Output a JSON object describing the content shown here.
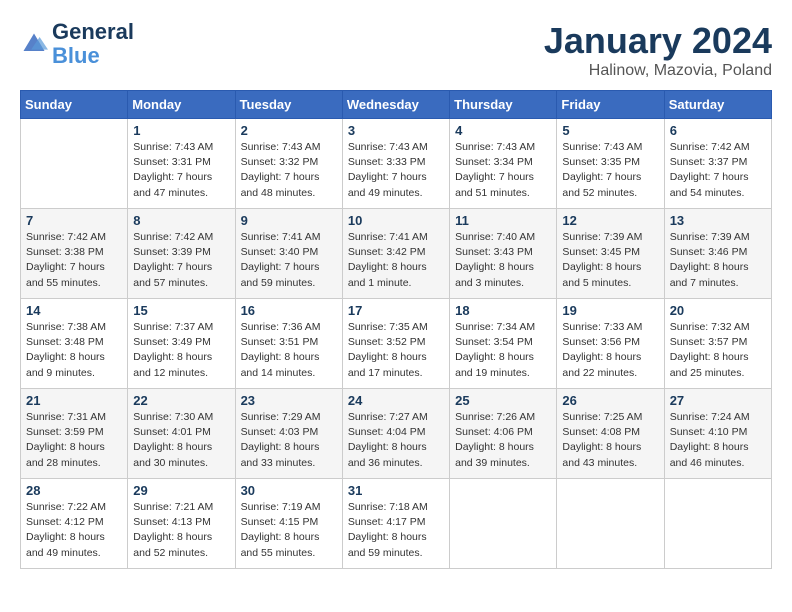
{
  "header": {
    "logo": {
      "line1": "General",
      "line2": "Blue"
    },
    "title": "January 2024",
    "location": "Halinow, Mazovia, Poland"
  },
  "days_of_week": [
    "Sunday",
    "Monday",
    "Tuesday",
    "Wednesday",
    "Thursday",
    "Friday",
    "Saturday"
  ],
  "weeks": [
    [
      {
        "day": "",
        "sunrise": "",
        "sunset": "",
        "daylight": ""
      },
      {
        "day": "1",
        "sunrise": "Sunrise: 7:43 AM",
        "sunset": "Sunset: 3:31 PM",
        "daylight": "Daylight: 7 hours and 47 minutes."
      },
      {
        "day": "2",
        "sunrise": "Sunrise: 7:43 AM",
        "sunset": "Sunset: 3:32 PM",
        "daylight": "Daylight: 7 hours and 48 minutes."
      },
      {
        "day": "3",
        "sunrise": "Sunrise: 7:43 AM",
        "sunset": "Sunset: 3:33 PM",
        "daylight": "Daylight: 7 hours and 49 minutes."
      },
      {
        "day": "4",
        "sunrise": "Sunrise: 7:43 AM",
        "sunset": "Sunset: 3:34 PM",
        "daylight": "Daylight: 7 hours and 51 minutes."
      },
      {
        "day": "5",
        "sunrise": "Sunrise: 7:43 AM",
        "sunset": "Sunset: 3:35 PM",
        "daylight": "Daylight: 7 hours and 52 minutes."
      },
      {
        "day": "6",
        "sunrise": "Sunrise: 7:42 AM",
        "sunset": "Sunset: 3:37 PM",
        "daylight": "Daylight: 7 hours and 54 minutes."
      }
    ],
    [
      {
        "day": "7",
        "sunrise": "Sunrise: 7:42 AM",
        "sunset": "Sunset: 3:38 PM",
        "daylight": "Daylight: 7 hours and 55 minutes."
      },
      {
        "day": "8",
        "sunrise": "Sunrise: 7:42 AM",
        "sunset": "Sunset: 3:39 PM",
        "daylight": "Daylight: 7 hours and 57 minutes."
      },
      {
        "day": "9",
        "sunrise": "Sunrise: 7:41 AM",
        "sunset": "Sunset: 3:40 PM",
        "daylight": "Daylight: 7 hours and 59 minutes."
      },
      {
        "day": "10",
        "sunrise": "Sunrise: 7:41 AM",
        "sunset": "Sunset: 3:42 PM",
        "daylight": "Daylight: 8 hours and 1 minute."
      },
      {
        "day": "11",
        "sunrise": "Sunrise: 7:40 AM",
        "sunset": "Sunset: 3:43 PM",
        "daylight": "Daylight: 8 hours and 3 minutes."
      },
      {
        "day": "12",
        "sunrise": "Sunrise: 7:39 AM",
        "sunset": "Sunset: 3:45 PM",
        "daylight": "Daylight: 8 hours and 5 minutes."
      },
      {
        "day": "13",
        "sunrise": "Sunrise: 7:39 AM",
        "sunset": "Sunset: 3:46 PM",
        "daylight": "Daylight: 8 hours and 7 minutes."
      }
    ],
    [
      {
        "day": "14",
        "sunrise": "Sunrise: 7:38 AM",
        "sunset": "Sunset: 3:48 PM",
        "daylight": "Daylight: 8 hours and 9 minutes."
      },
      {
        "day": "15",
        "sunrise": "Sunrise: 7:37 AM",
        "sunset": "Sunset: 3:49 PM",
        "daylight": "Daylight: 8 hours and 12 minutes."
      },
      {
        "day": "16",
        "sunrise": "Sunrise: 7:36 AM",
        "sunset": "Sunset: 3:51 PM",
        "daylight": "Daylight: 8 hours and 14 minutes."
      },
      {
        "day": "17",
        "sunrise": "Sunrise: 7:35 AM",
        "sunset": "Sunset: 3:52 PM",
        "daylight": "Daylight: 8 hours and 17 minutes."
      },
      {
        "day": "18",
        "sunrise": "Sunrise: 7:34 AM",
        "sunset": "Sunset: 3:54 PM",
        "daylight": "Daylight: 8 hours and 19 minutes."
      },
      {
        "day": "19",
        "sunrise": "Sunrise: 7:33 AM",
        "sunset": "Sunset: 3:56 PM",
        "daylight": "Daylight: 8 hours and 22 minutes."
      },
      {
        "day": "20",
        "sunrise": "Sunrise: 7:32 AM",
        "sunset": "Sunset: 3:57 PM",
        "daylight": "Daylight: 8 hours and 25 minutes."
      }
    ],
    [
      {
        "day": "21",
        "sunrise": "Sunrise: 7:31 AM",
        "sunset": "Sunset: 3:59 PM",
        "daylight": "Daylight: 8 hours and 28 minutes."
      },
      {
        "day": "22",
        "sunrise": "Sunrise: 7:30 AM",
        "sunset": "Sunset: 4:01 PM",
        "daylight": "Daylight: 8 hours and 30 minutes."
      },
      {
        "day": "23",
        "sunrise": "Sunrise: 7:29 AM",
        "sunset": "Sunset: 4:03 PM",
        "daylight": "Daylight: 8 hours and 33 minutes."
      },
      {
        "day": "24",
        "sunrise": "Sunrise: 7:27 AM",
        "sunset": "Sunset: 4:04 PM",
        "daylight": "Daylight: 8 hours and 36 minutes."
      },
      {
        "day": "25",
        "sunrise": "Sunrise: 7:26 AM",
        "sunset": "Sunset: 4:06 PM",
        "daylight": "Daylight: 8 hours and 39 minutes."
      },
      {
        "day": "26",
        "sunrise": "Sunrise: 7:25 AM",
        "sunset": "Sunset: 4:08 PM",
        "daylight": "Daylight: 8 hours and 43 minutes."
      },
      {
        "day": "27",
        "sunrise": "Sunrise: 7:24 AM",
        "sunset": "Sunset: 4:10 PM",
        "daylight": "Daylight: 8 hours and 46 minutes."
      }
    ],
    [
      {
        "day": "28",
        "sunrise": "Sunrise: 7:22 AM",
        "sunset": "Sunset: 4:12 PM",
        "daylight": "Daylight: 8 hours and 49 minutes."
      },
      {
        "day": "29",
        "sunrise": "Sunrise: 7:21 AM",
        "sunset": "Sunset: 4:13 PM",
        "daylight": "Daylight: 8 hours and 52 minutes."
      },
      {
        "day": "30",
        "sunrise": "Sunrise: 7:19 AM",
        "sunset": "Sunset: 4:15 PM",
        "daylight": "Daylight: 8 hours and 55 minutes."
      },
      {
        "day": "31",
        "sunrise": "Sunrise: 7:18 AM",
        "sunset": "Sunset: 4:17 PM",
        "daylight": "Daylight: 8 hours and 59 minutes."
      },
      {
        "day": "",
        "sunrise": "",
        "sunset": "",
        "daylight": ""
      },
      {
        "day": "",
        "sunrise": "",
        "sunset": "",
        "daylight": ""
      },
      {
        "day": "",
        "sunrise": "",
        "sunset": "",
        "daylight": ""
      }
    ]
  ]
}
